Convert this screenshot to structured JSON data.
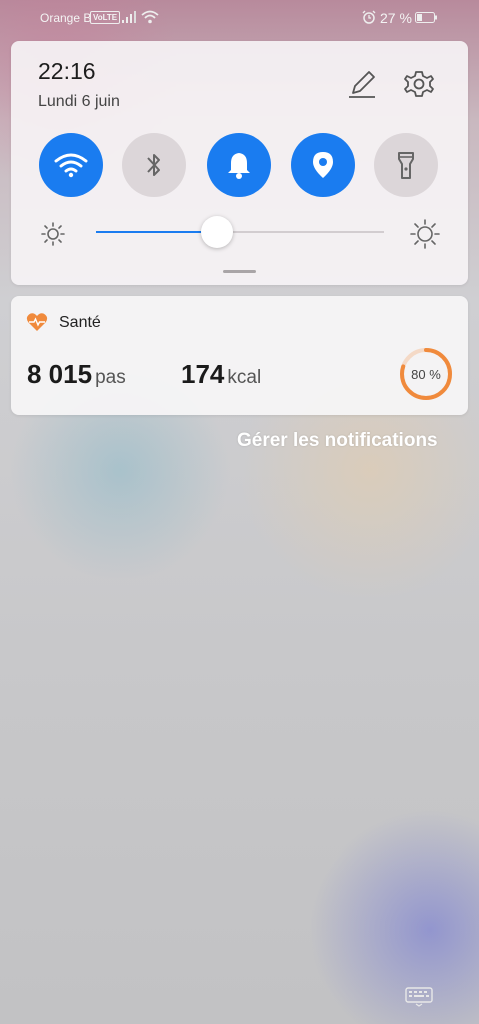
{
  "status_bar": {
    "carrier": "Orange B",
    "network_badge": "VoLTE",
    "battery_percent": "27 %",
    "icons": [
      "signal-icon",
      "wifi-icon",
      "alarm-icon",
      "battery-icon"
    ]
  },
  "quick_panel": {
    "time": "22:16",
    "date": "Lundi 6 juin",
    "toggles": [
      {
        "name": "wifi",
        "icon": "wifi-icon",
        "on": true
      },
      {
        "name": "bluetooth",
        "icon": "bluetooth-icon",
        "on": false
      },
      {
        "name": "sound",
        "icon": "bell-icon",
        "on": true
      },
      {
        "name": "location",
        "icon": "location-pin-icon",
        "on": true
      },
      {
        "name": "flashlight",
        "icon": "flashlight-icon",
        "on": false
      }
    ],
    "brightness_level": 0.42,
    "accent_color": "#1a7cf0"
  },
  "health": {
    "title": "Santé",
    "steps_value": "8 015",
    "steps_unit": "pas",
    "kcal_value": "174",
    "kcal_unit": "kcal",
    "goal_progress": 0.8,
    "goal_label": "80 %",
    "accent_color": "#f08a3c"
  },
  "manage_notifications": "Gérer les notifications"
}
